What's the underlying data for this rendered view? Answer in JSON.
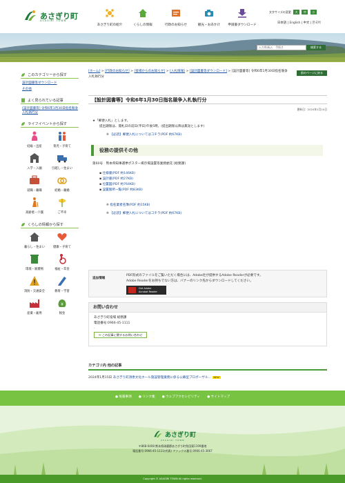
{
  "site": {
    "name": "あさぎり町",
    "name_en": "ASAGIRI TOWN"
  },
  "gnav": [
    {
      "label": "あさぎり町の紹介",
      "icon": "town-icon"
    },
    {
      "label": "くらしの情報",
      "icon": "home-icon"
    },
    {
      "label": "行政のお知らせ",
      "icon": "info-icon"
    },
    {
      "label": "観光・おあかけ",
      "icon": "camera-icon"
    },
    {
      "label": "申請書ダウンロード",
      "icon": "download-icon"
    }
  ],
  "tools": {
    "font_size_label": "文字サイズの変更",
    "sizes": [
      "大",
      "中",
      "小"
    ]
  },
  "languages": "日本語 | English | 中文 | 한국어",
  "search": {
    "placeholder": "入力例)転入　手続き",
    "button": "検索する"
  },
  "sidebar": {
    "category_heading": "このカテゴリーから探す",
    "category_links": [
      "設計図書等ダウンロード",
      "その他"
    ],
    "popular_heading": "よく見られている記事",
    "popular_links": [
      "[設計図書等] 令和6年1月30日指名競争入札執行分"
    ],
    "life_heading": "ライフイベントから探す",
    "life_items": [
      {
        "label": "妊娠・出産",
        "icon": "pregnancy-icon",
        "color": "#e94e8a"
      },
      {
        "label": "育児・子育て",
        "icon": "family-icon",
        "color": "#e65a3a"
      },
      {
        "label": "入学・入園",
        "icon": "school-icon",
        "color": "#555555"
      },
      {
        "label": "引越し・住まい",
        "icon": "truck-icon",
        "color": "#3a6fb0"
      },
      {
        "label": "就職・離職",
        "icon": "briefcase-icon",
        "color": "#c5503a"
      },
      {
        "label": "結婚・離婚",
        "icon": "rings-icon",
        "color": "#e0a020"
      },
      {
        "label": "高齢者・介護",
        "icon": "elderly-icon",
        "color": "#e07a20"
      },
      {
        "label": "ご不幸",
        "icon": "flower-icon",
        "color": "#e0b020"
      }
    ],
    "living_heading": "くらしの情報から探す",
    "living_items": [
      {
        "label": "暮らし・住まい",
        "icon": "house-icon",
        "color": "#555555"
      },
      {
        "label": "健康・子育て",
        "icon": "heart-icon",
        "color": "#e65a3a"
      },
      {
        "label": "環境・廃棄物",
        "icon": "recycle-icon",
        "color": "#3a8a3a"
      },
      {
        "label": "福祉・年金",
        "icon": "welfare-icon",
        "color": "#c5303a"
      },
      {
        "label": "消防・交通安全",
        "icon": "warning-icon",
        "color": "#e0a020"
      },
      {
        "label": "教育・学習",
        "icon": "pencil-icon",
        "color": "#3a6fb0"
      },
      {
        "label": "産業・雇用",
        "icon": "factory-icon",
        "color": "#c5303a"
      },
      {
        "label": "税金",
        "icon": "money-icon",
        "color": "#5a9a3a"
      }
    ]
  },
  "breadcrumb": {
    "items": [
      "[ホーム]",
      "[行政のお知らせ]",
      "[役場からのお知らせ]",
      "[入札情報]",
      "[設計図書等ダウンロード]"
    ],
    "current": "[設計図書等] 令和6年1月30日指名競争入札執行分",
    "sep": " > "
  },
  "print_button": "前のページに戻る",
  "page": {
    "title": "【設計図書等】令和6年1月30日指名競争入札執行分",
    "updated": "更新日：2024年1月10日",
    "mail_note": "★「郵便入札」とします。",
    "deadline_note": "提出期限は、開札日の前日(平日)午後5時。(提出期限以降は無効とします)",
    "notice_link": "【必読】郵便入札についてはコチラ(PDF 約67KB)",
    "section_heading": "役務の提供その他",
    "project": "第60号　熊本県知事選挙ポスター掲示場設置等業務委託 [総務課]",
    "files": [
      "仕様書(PDF 約146KB)",
      "設計書(PDF 約27KB)",
      "位置図(PDF 約764KB)",
      "設置箇所一覧(PDF 約83KB)"
    ],
    "form_link": "指名業者名簿(PDF 約15KB)",
    "notice_link_2": "【必読】郵便入札についてはコチラ(PDF 約67KB)"
  },
  "info": {
    "label": "追加情報",
    "line1": "PDF形式のファイルをご覧いただく場合には、Adobe社が提供するAdobe Readerが必要です。",
    "line2": "Adobe Readerをお持ちでない方は、バナーのリンク先からダウンロードしてください。",
    "adobe_label_1": "Get Adobe",
    "adobe_label_2": "Acrobat Reader"
  },
  "contact": {
    "heading": "お問い合わせ",
    "dept": "あさぎり町役場 総務課",
    "phone": "電話番号:0966-45-1111",
    "extra": ".",
    "button": "この記事に関するお問い合わせ"
  },
  "related": {
    "heading": "カテゴリ内 他の記事",
    "date": "2024年1月15日",
    "link": "あさぎり町須恵文化ホール施設管理業務に係る公募型プロポーザル…",
    "badge": "NEW"
  },
  "footer": {
    "links": [
      "免責事項",
      "リンク集",
      "ウェブアクセシビリティ",
      "サイトマップ"
    ],
    "addr1": "〒868-0408 熊本県球磨郡あさぎり町免田東1199番地",
    "addr2": "電話番号:0966-45-1111(代表) ファックス番号:0966-45-3667",
    "copyright": "Copyright © ASAGIRI TOWN All rights reserved."
  }
}
